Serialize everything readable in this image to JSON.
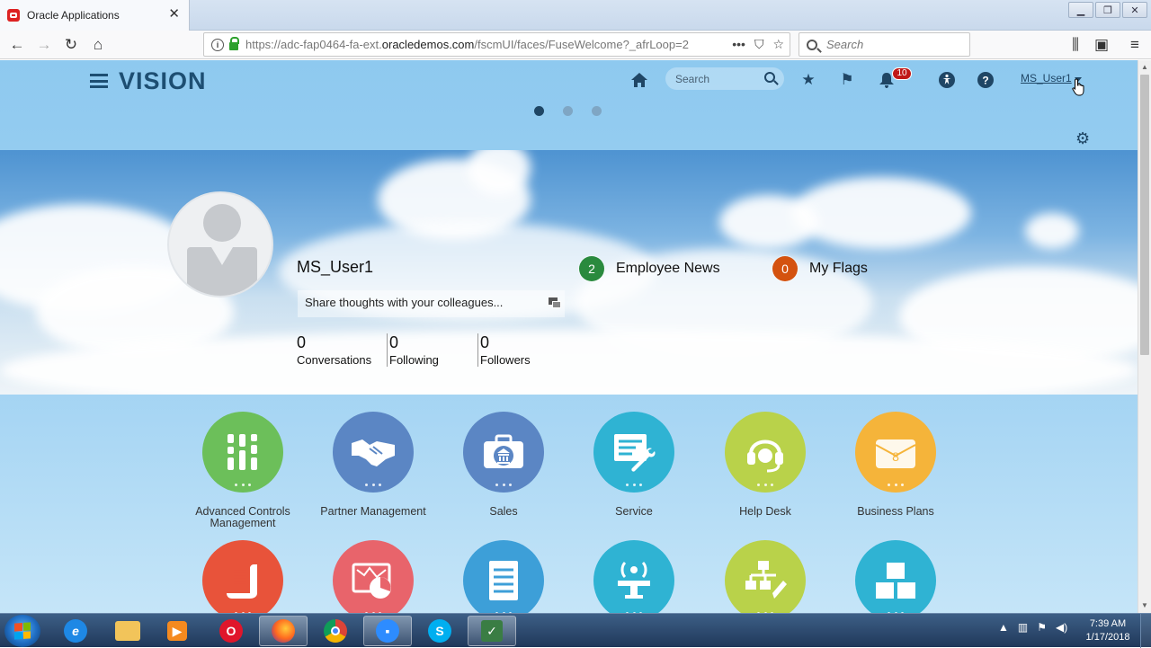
{
  "browser": {
    "tab_title": "Oracle Applications",
    "url_prefix": "https://adc-fap0464-fa-ext.",
    "url_domain": "oracledemos.com",
    "url_path": "/fscmUI/faces/FuseWelcome?_afrLoop=2",
    "search_placeholder": "Search"
  },
  "global_header": {
    "brand": "VISION",
    "search_placeholder": "Search",
    "notification_count": "10",
    "user_name": "MS_User1"
  },
  "carousel": {
    "pages": 3,
    "active": 0
  },
  "profile": {
    "name": "MS_User1",
    "share_prompt": "Share thoughts with your colleagues...",
    "stats": [
      {
        "count": "0",
        "label": "Conversations"
      },
      {
        "count": "0",
        "label": "Following"
      },
      {
        "count": "0",
        "label": "Followers"
      }
    ],
    "employee_news": {
      "count": "2",
      "label": "Employee News",
      "color": "#2a8a3e"
    },
    "my_flags": {
      "count": "0",
      "label": "My Flags",
      "color": "#d4520f"
    }
  },
  "apps": [
    {
      "label": "Advanced Controls Management",
      "color": "#6cbf5a",
      "icon": "sliders-icon"
    },
    {
      "label": "Partner Management",
      "color": "#5b86c4",
      "icon": "handshake-icon"
    },
    {
      "label": "Sales",
      "color": "#5b86c4",
      "icon": "briefcase-icon"
    },
    {
      "label": "Service",
      "color": "#2fb3d3",
      "icon": "service-icon"
    },
    {
      "label": "Help Desk",
      "color": "#b9d24a",
      "icon": "headset-icon"
    },
    {
      "label": "Business Plans",
      "color": "#f5b43a",
      "icon": "case-icon"
    },
    {
      "label": "",
      "color": "#e8533a",
      "icon": "scroll-icon"
    },
    {
      "label": "",
      "color": "#e8646b",
      "icon": "map-icon"
    },
    {
      "label": "",
      "color": "#3d9fd8",
      "icon": "document-icon"
    },
    {
      "label": "",
      "color": "#2fb3d3",
      "icon": "broadcast-icon"
    },
    {
      "label": "",
      "color": "#b9d24a",
      "icon": "org-edit-icon"
    },
    {
      "label": "",
      "color": "#2fb3d3",
      "icon": "blocks-icon"
    }
  ],
  "taskbar": {
    "time": "7:39 AM",
    "date": "1/17/2018"
  }
}
